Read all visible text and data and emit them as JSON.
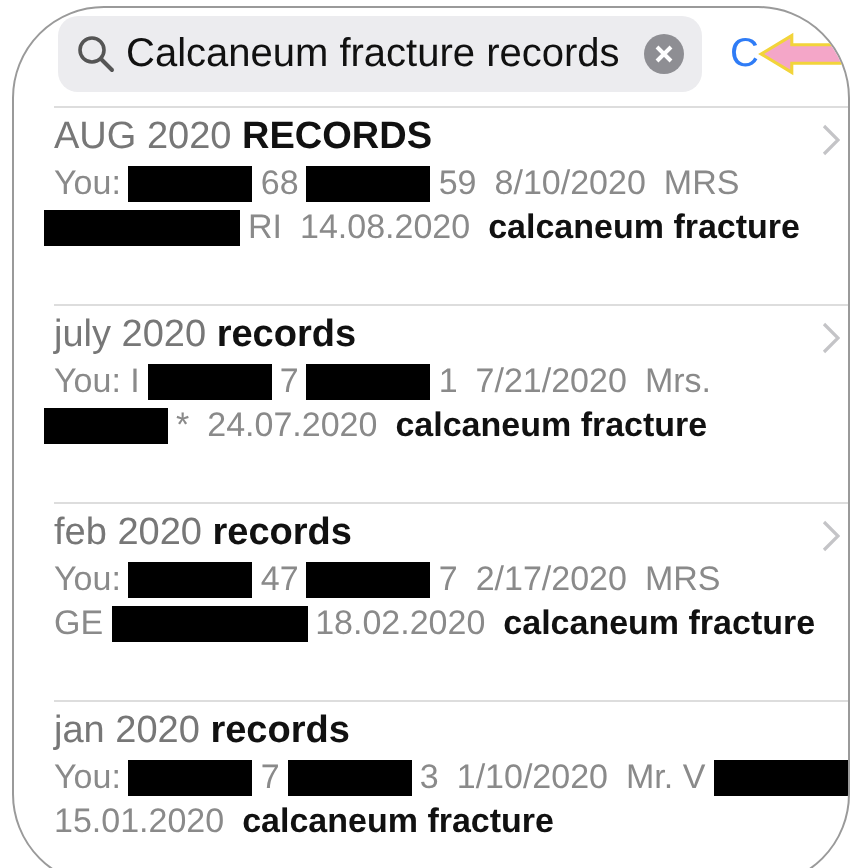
{
  "search": {
    "value": "Calcaneum fracture records"
  },
  "cancel_button": {
    "label": "C"
  },
  "results": [
    {
      "title": "AUG 2020 **RECORDS**",
      "lines": [
        [
          {
            "kind": "text",
            "text": "You:"
          },
          {
            "kind": "redacted"
          },
          {
            "kind": "text",
            "text": "68"
          },
          {
            "kind": "redacted"
          },
          {
            "kind": "text",
            "text": "59"
          },
          {
            "kind": "text",
            "text": "8/10/2020"
          },
          {
            "kind": "text",
            "text": "MRS"
          }
        ],
        [
          {
            "kind": "redacted-long"
          },
          {
            "kind": "text",
            "text": "RI"
          },
          {
            "kind": "text",
            "text": "14.08.2020"
          },
          {
            "kind": "strong",
            "text": "calcaneum fracture"
          }
        ]
      ]
    },
    {
      "title": "july 2020 **records**",
      "lines": [
        [
          {
            "kind": "text",
            "text": "You: I"
          },
          {
            "kind": "redacted"
          },
          {
            "kind": "text",
            "text": "7"
          },
          {
            "kind": "redacted"
          },
          {
            "kind": "text",
            "text": "1"
          },
          {
            "kind": "text",
            "text": "7/21/2020"
          },
          {
            "kind": "text",
            "text": "Mrs."
          }
        ],
        [
          {
            "kind": "redacted"
          },
          {
            "kind": "text",
            "text": "*"
          },
          {
            "kind": "text",
            "text": "24.07.2020"
          },
          {
            "kind": "strong",
            "text": "calcaneum fracture"
          }
        ]
      ]
    },
    {
      "title": "feb 2020 **records**",
      "lines": [
        [
          {
            "kind": "text",
            "text": "You:"
          },
          {
            "kind": "redacted"
          },
          {
            "kind": "text",
            "text": "47"
          },
          {
            "kind": "redacted"
          },
          {
            "kind": "text",
            "text": "7"
          },
          {
            "kind": "text",
            "text": "2/17/2020"
          },
          {
            "kind": "text",
            "text": "MRS"
          }
        ],
        [
          {
            "kind": "text",
            "text": "GE"
          },
          {
            "kind": "redacted-long"
          },
          {
            "kind": "text",
            "text": "18.02.2020"
          },
          {
            "kind": "strong",
            "text": "calcaneum fracture"
          }
        ]
      ]
    },
    {
      "title": "jan 2020 **records**",
      "lines": [
        [
          {
            "kind": "text",
            "text": "You:"
          },
          {
            "kind": "redacted"
          },
          {
            "kind": "text",
            "text": "7"
          },
          {
            "kind": "redacted"
          },
          {
            "kind": "text",
            "text": "3"
          },
          {
            "kind": "text",
            "text": "1/10/2020"
          },
          {
            "kind": "text",
            "text": "Mr. V"
          },
          {
            "kind": "redacted-long"
          }
        ],
        [
          {
            "kind": "text",
            "text": "15.01.2020"
          },
          {
            "kind": "strong",
            "text": "calcaneum fracture"
          }
        ]
      ]
    }
  ]
}
